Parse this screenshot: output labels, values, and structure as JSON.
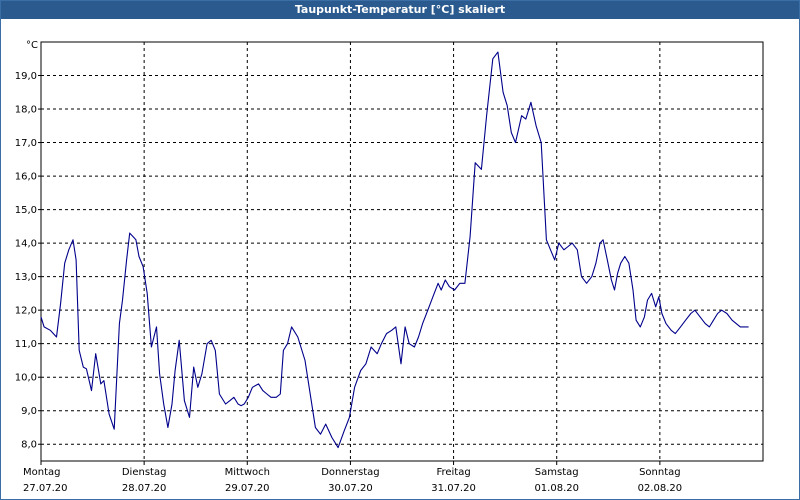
{
  "window": {
    "title": "Taupunkt-Temperatur [°C] skaliert"
  },
  "chart_data": {
    "type": "line",
    "title": "Taupunkt-Temperatur [°C] skaliert",
    "ylabel": "°C",
    "xlabel": "",
    "ylim": [
      7.5,
      20.0
    ],
    "xlim": [
      0,
      7
    ],
    "yticks": [
      8.0,
      9.0,
      10.0,
      11.0,
      12.0,
      13.0,
      14.0,
      15.0,
      16.0,
      17.0,
      18.0,
      19.0
    ],
    "ytick_labels": [
      "8,0",
      "9,0",
      "10,0",
      "11,0",
      "12,0",
      "13,0",
      "14,0",
      "15,0",
      "16,0",
      "17,0",
      "18,0",
      "19,0"
    ],
    "xticks": [
      {
        "x": 0,
        "day": "Montag",
        "date": "27.07.20"
      },
      {
        "x": 1,
        "day": "Dienstag",
        "date": "28.07.20"
      },
      {
        "x": 2,
        "day": "Mittwoch",
        "date": "29.07.20"
      },
      {
        "x": 3,
        "day": "Donnerstag",
        "date": "30.07.20"
      },
      {
        "x": 4,
        "day": "Freitag",
        "date": "31.07.20"
      },
      {
        "x": 5,
        "day": "Samstag",
        "date": "01.08.20"
      },
      {
        "x": 6,
        "day": "Sonntag",
        "date": "02.08.20"
      }
    ],
    "grid": true,
    "line_color": "#00008b",
    "series": [
      {
        "x": [
          0,
          0.03,
          0.09,
          0.15,
          0.19,
          0.23,
          0.27,
          0.31,
          0.34,
          0.37,
          0.41,
          0.44,
          0.49,
          0.53,
          0.58,
          0.61,
          0.66,
          0.71,
          0.76,
          0.79,
          0.83,
          0.86,
          0.89,
          0.92,
          0.95,
          0.99,
          1.03,
          1.07,
          1.12,
          1.15,
          1.19,
          1.23,
          1.27,
          1.3,
          1.34,
          1.39,
          1.44,
          1.48,
          1.52,
          1.56,
          1.61,
          1.65,
          1.69,
          1.73,
          1.79,
          1.83,
          1.87,
          1.91,
          1.94,
          1.97,
          2.01,
          2.05,
          2.11,
          2.15,
          2.19,
          2.23,
          2.28,
          2.32,
          2.35,
          2.39,
          2.43,
          2.49,
          2.56,
          2.61,
          2.66,
          2.71,
          2.76,
          2.82,
          2.88,
          2.94,
          2.99,
          3.04,
          3.1,
          3.15,
          3.2,
          3.26,
          3.3,
          3.35,
          3.4,
          3.44,
          3.49,
          3.53,
          3.57,
          3.62,
          3.66,
          3.7,
          3.75,
          3.8,
          3.85,
          3.88,
          3.92,
          3.96,
          4.01,
          4.06,
          4.11,
          4.16,
          4.21,
          4.27,
          4.32,
          4.38,
          4.43,
          4.48,
          4.52,
          4.56,
          4.6,
          4.66,
          4.7,
          4.75,
          4.8,
          4.85,
          4.9,
          4.94,
          4.98,
          5.02,
          5.07,
          5.11,
          5.15,
          5.2,
          5.24,
          5.29,
          5.34,
          5.38,
          5.42,
          5.45,
          5.49,
          5.53,
          5.56,
          5.59,
          5.62,
          5.66,
          5.7,
          5.74,
          5.77,
          5.81,
          5.85,
          5.88,
          5.92,
          5.96,
          5.99,
          6.02,
          6.06,
          6.11,
          6.15,
          6.2,
          6.25,
          6.3,
          6.34,
          6.39,
          6.44,
          6.48,
          6.52,
          6.56,
          6.6,
          6.65,
          6.7,
          6.74,
          6.78,
          6.81,
          6.84,
          6.86
        ],
        "y": [
          11.8,
          11.5,
          11.4,
          11.2,
          12.2,
          13.4,
          13.8,
          14.1,
          13.5,
          10.8,
          10.3,
          10.25,
          9.6,
          10.7,
          9.8,
          9.9,
          8.9,
          8.45,
          11.6,
          12.3,
          13.5,
          14.3,
          14.2,
          14.1,
          13.6,
          13.3,
          12.5,
          10.9,
          11.5,
          10.1,
          9.2,
          8.5,
          9.2,
          10.2,
          11.1,
          9.3,
          8.8,
          10.3,
          9.7,
          10.1,
          11.0,
          11.1,
          10.8,
          9.5,
          9.2,
          9.3,
          9.4,
          9.2,
          9.15,
          9.2,
          9.4,
          9.7,
          9.8,
          9.6,
          9.5,
          9.4,
          9.4,
          9.5,
          10.8,
          11.0,
          11.5,
          11.2,
          10.5,
          9.5,
          8.5,
          8.3,
          8.6,
          8.2,
          7.9,
          8.4,
          8.8,
          9.7,
          10.2,
          10.4,
          10.9,
          10.7,
          11.0,
          11.3,
          11.4,
          11.5,
          10.4,
          11.5,
          11.0,
          10.9,
          11.2,
          11.6,
          12.0,
          12.4,
          12.8,
          12.6,
          12.9,
          12.7,
          12.6,
          12.8,
          12.8,
          14.2,
          16.4,
          16.2,
          17.8,
          19.5,
          19.7,
          18.5,
          18.1,
          17.3,
          17.0,
          17.8,
          17.7,
          18.2,
          17.5,
          17.0,
          14.1,
          13.8,
          13.5,
          14.0,
          13.8,
          13.9,
          14.0,
          13.8,
          13.0,
          12.8,
          13.0,
          13.4,
          14.0,
          14.1,
          13.5,
          12.9,
          12.6,
          13.1,
          13.4,
          13.6,
          13.4,
          12.6,
          11.7,
          11.5,
          11.8,
          12.3,
          12.5,
          12.1,
          12.4,
          11.9,
          11.6,
          11.4,
          11.3,
          11.5,
          11.7,
          11.9,
          12.0,
          11.8,
          11.6,
          11.5,
          11.7,
          11.9,
          12.0,
          11.9,
          11.7,
          11.6,
          11.5,
          11.5,
          11.5,
          11.5
        ]
      }
    ]
  }
}
